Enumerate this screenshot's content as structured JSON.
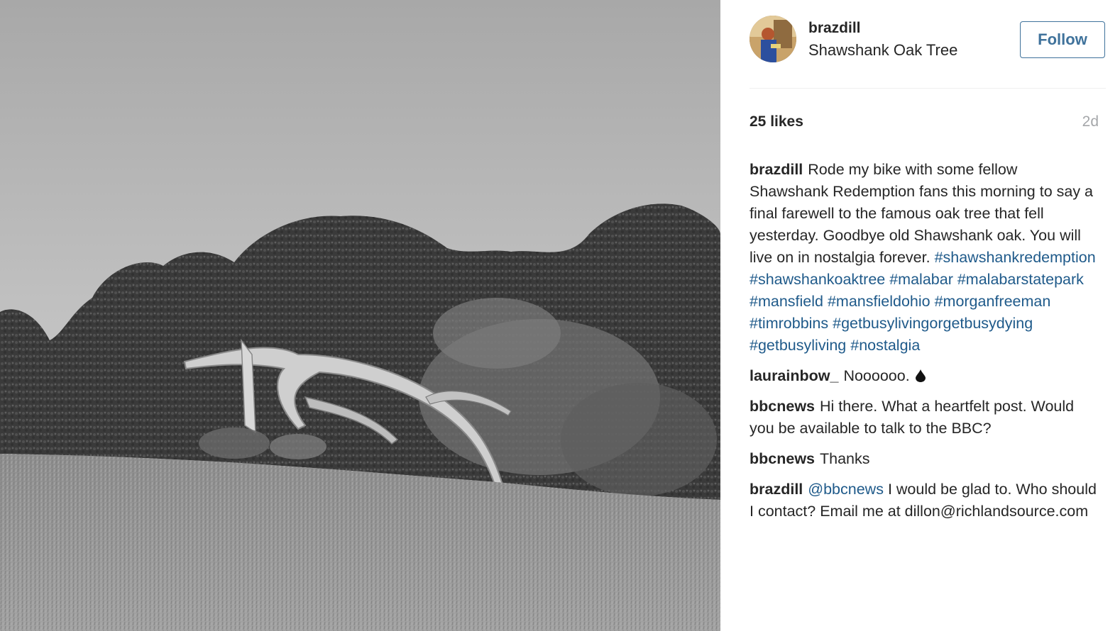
{
  "post": {
    "username": "brazdill",
    "location": "Shawshank Oak Tree",
    "follow_label": "Follow",
    "likes": "25 likes",
    "time": "2d"
  },
  "caption": {
    "user": "brazdill",
    "text": "Rode my bike with some fellow Shawshank Redemption fans this morning to say a final farewell to the famous oak tree that fell yesterday. Goodbye old Shawshank oak. You will live on in nostalgia forever.",
    "tags": [
      "#shawshankredemption",
      "#shawshankoaktree",
      "#malabar",
      "#malabarstatepark",
      "#mansfield",
      "#mansfieldohio",
      "#morganfreeman",
      "#timrobbins",
      "#getbusylivingorgetbusydying",
      "#getbusyliving",
      "#nostalgia"
    ]
  },
  "comments": [
    {
      "user": "laurainbow_",
      "text": "Noooooo.",
      "emoji": "drop-icon"
    },
    {
      "user": "bbcnews",
      "text": "Hi there. What a heartfelt post. Would you be available to talk to the BBC?"
    },
    {
      "user": "bbcnews",
      "text": "Thanks"
    },
    {
      "user": "brazdill",
      "mention": "@bbcnews",
      "text": "I would be glad to. Who should I contact? Email me at dillon@richlandsource.com"
    }
  ],
  "colors": {
    "link": "#1f5a8a",
    "follow": "#3f729b",
    "muted": "#a5a7aa"
  }
}
